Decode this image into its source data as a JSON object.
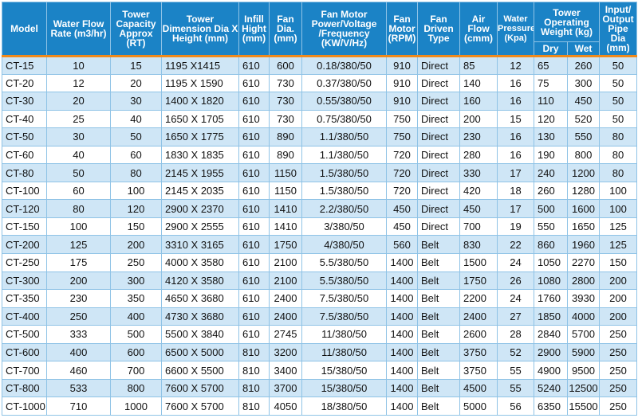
{
  "headers": {
    "model": "Model",
    "water_flow": "Water Flow Rate (m3/hr)",
    "capacity": "Tower Capacity Approx (RT)",
    "dimension": "Tower Dimension Dia X Height (mm)",
    "infill": "Infill Hight (mm)",
    "fan_dia": "Fan Dia. (mm)",
    "fan_motor_power": "Fan Motor Power/Voltage /Frequency (KW/V/Hz)",
    "fan_motor_rpm": "Fan Motor (RPM)",
    "fan_driven": "Fan Driven Type",
    "air_flow": "Air Flow (cmm)",
    "water_pressure": "Water Pressure (Kpa)",
    "weight": "Tower Operating Weight (kg)",
    "weight_dry": "Dry",
    "weight_wet": "Wet",
    "pipe": "Input/ Output Pipe Dia (mm)"
  },
  "rows": [
    [
      "CT-15",
      "10",
      "15",
      "1195 X1415",
      "610",
      "600",
      "0.18/380/50",
      "910",
      "Direct",
      "85",
      "12",
      "65",
      "260",
      "50"
    ],
    [
      "CT-20",
      "12",
      "20",
      "1195 X 1590",
      "610",
      "730",
      "0.37/380/50",
      "910",
      "Direct",
      "140",
      "16",
      "75",
      "300",
      "50"
    ],
    [
      "CT-30",
      "20",
      "30",
      "1400 X 1820",
      "610",
      "730",
      "0.55/380/50",
      "910",
      "Direct",
      "160",
      "16",
      "110",
      "450",
      "50"
    ],
    [
      "CT-40",
      "25",
      "40",
      "1650 X 1705",
      "610",
      "730",
      "0.75/380/50",
      "750",
      "Direct",
      "200",
      "15",
      "120",
      "520",
      "50"
    ],
    [
      "CT-50",
      "30",
      "50",
      "1650 X 1775",
      "610",
      "890",
      "1.1/380/50",
      "750",
      "Direct",
      "230",
      "16",
      "130",
      "550",
      "80"
    ],
    [
      "CT-60",
      "40",
      "60",
      "1830 X 1835",
      "610",
      "890",
      "1.1/380/50",
      "720",
      "Direct",
      "280",
      "16",
      "190",
      "800",
      "80"
    ],
    [
      "CT-80",
      "50",
      "80",
      "2145 X 1955",
      "610",
      "1150",
      "1.5/380/50",
      "720",
      "Direct",
      "330",
      "17",
      "240",
      "1200",
      "80"
    ],
    [
      "CT-100",
      "60",
      "100",
      "2145 X 2035",
      "610",
      "1150",
      "1.5/380/50",
      "720",
      "Direct",
      "420",
      "18",
      "260",
      "1280",
      "100"
    ],
    [
      "CT-120",
      "80",
      "120",
      "2900 X 2370",
      "610",
      "1410",
      "2.2/380/50",
      "450",
      "Direct",
      "450",
      "17",
      "500",
      "1600",
      "100"
    ],
    [
      "CT-150",
      "100",
      "150",
      "2900 X 2555",
      "610",
      "1410",
      "3/380/50",
      "450",
      "Direct",
      "700",
      "19",
      "550",
      "1650",
      "125"
    ],
    [
      "CT-200",
      "125",
      "200",
      "3310 X 3165",
      "610",
      "1750",
      "4/380/50",
      "560",
      "Belt",
      "830",
      "22",
      "860",
      "1960",
      "125"
    ],
    [
      "CT-250",
      "175",
      "250",
      "4000 X 3580",
      "610",
      "2100",
      "5.5/380/50",
      "1400",
      "Belt",
      "1500",
      "24",
      "1050",
      "2270",
      "150"
    ],
    [
      "CT-300",
      "200",
      "300",
      "4120 X 3580",
      "610",
      "2100",
      "5.5/380/50",
      "1400",
      "Belt",
      "1750",
      "26",
      "1080",
      "2800",
      "200"
    ],
    [
      "CT-350",
      "230",
      "350",
      "4650 X 3680",
      "610",
      "2400",
      "7.5/380/50",
      "1400",
      "Belt",
      "2200",
      "24",
      "1760",
      "3930",
      "200"
    ],
    [
      "CT-400",
      "250",
      "400",
      "4730 X 3680",
      "610",
      "2400",
      "7.5/380/50",
      "1400",
      "Belt",
      "2400",
      "27",
      "1850",
      "4000",
      "200"
    ],
    [
      "CT-500",
      "333",
      "500",
      "5500 X 3840",
      "610",
      "2745",
      "11/380/50",
      "1400",
      "Belt",
      "2600",
      "28",
      "2840",
      "5700",
      "250"
    ],
    [
      "CT-600",
      "400",
      "600",
      "6500 X 5000",
      "810",
      "3200",
      "11/380/50",
      "1400",
      "Belt",
      "3750",
      "52",
      "2900",
      "5900",
      "250"
    ],
    [
      "CT-700",
      "460",
      "700",
      "6600 X 5500",
      "810",
      "3400",
      "15/380/50",
      "1400",
      "Belt",
      "3750",
      "55",
      "4900",
      "9500",
      "250"
    ],
    [
      "CT-800",
      "533",
      "800",
      "7600 X 5700",
      "810",
      "3700",
      "15/380/50",
      "1400",
      "Belt",
      "4500",
      "55",
      "5240",
      "12500",
      "250"
    ],
    [
      "CT-1000",
      "710",
      "1000",
      "7600 X 5700",
      "810",
      "4050",
      "18/380/50",
      "1400",
      "Belt",
      "5000",
      "56",
      "6350",
      "15500",
      "250"
    ]
  ],
  "colors": {
    "header_bg": "#1b83c6",
    "header_text": "#ffffff",
    "row_alt_bg": "#cfe6f6",
    "row_bg": "#ffffff",
    "header_separator": "#f08a1c",
    "grid_line": "#8fc3e6"
  }
}
